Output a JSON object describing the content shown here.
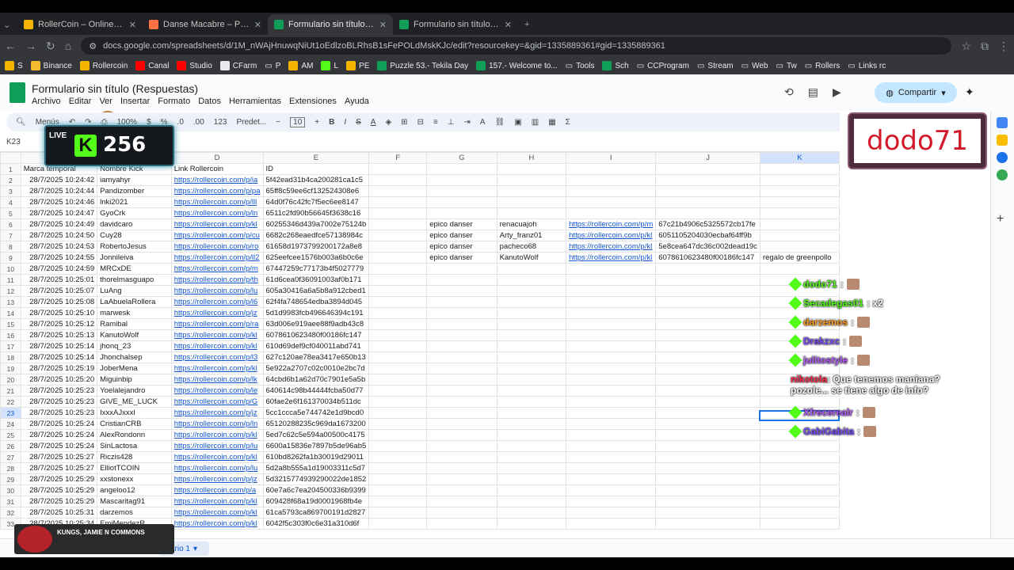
{
  "browser": {
    "tabs": [
      {
        "title": "RollerCoin – Online Bitcoin Mining",
        "active": false,
        "color": "#f4b400"
      },
      {
        "title": "Danse Macabre – Piero",
        "active": false,
        "color": "#ff7043"
      },
      {
        "title": "Formulario sin título (Respuestas)",
        "active": true,
        "color": "#0f9d58"
      },
      {
        "title": "Formulario sin título (Respuestas)",
        "active": false,
        "color": "#0f9d58"
      }
    ],
    "url": "docs.google.com/spreadsheets/d/1M_nWAjHnuwqNiUt1oEdlzoBLRhsB1sFePOLdMskKJc/edit?resourcekey=&gid=1335889361#gid=1335889361",
    "bookmarks": [
      "S",
      "Binance",
      "Rollercoin",
      "Canal",
      "Studio",
      "CFarm",
      "P",
      "AM",
      "L",
      "PE",
      "Puzzle 53.- Tekila Day",
      "157.- Welcome to...",
      "Tools",
      "Sch",
      "CCProgram",
      "Stream",
      "Web",
      "Tw",
      "Rollers",
      "Links rc"
    ]
  },
  "sheet": {
    "title": "Formulario sin título (Respuestas)",
    "menus": [
      "Archivo",
      "Editar",
      "Ver",
      "Insertar",
      "Formato",
      "Datos",
      "Herramientas",
      "Extensiones",
      "Ayuda"
    ],
    "share_label": "Compartir",
    "toolbar": {
      "menus": "Menús",
      "zoom": "100%",
      "currency": "$",
      "percent": "%",
      "dec_minus": ".0",
      "dec_plus": ".00",
      "num_format": "123",
      "font": "Predet...",
      "font_size": "10",
      "sum": "Σ"
    },
    "cell_ref": "K23",
    "columns": [
      "",
      "Marca temporal",
      "Nombre Kick",
      "D",
      "E",
      "F",
      "G",
      "H",
      "I",
      "J",
      "K"
    ],
    "header_row": [
      "Marca temporal",
      "Nombre Kick",
      "Link Rollercoin",
      "ID",
      "",
      "",
      "",
      "",
      "",
      ""
    ],
    "rows": [
      [
        "2",
        "28/7/2025 10:24:42",
        "iamyahyr",
        "https://rollercoin.com/p/ia",
        "5f42ead31b4ca200281ca1c5",
        "",
        "",
        "",
        "",
        "",
        ""
      ],
      [
        "3",
        "28/7/2025 10:24:44",
        "Pandizomber",
        "https://rollercoin.com/p/pa",
        "65ff8c59ee6cf132524308e6",
        "",
        "",
        "",
        "",
        "",
        ""
      ],
      [
        "4",
        "28/7/2025 10:24:46",
        "lnki2021",
        "https://rollercoin.com/p/lll",
        "64d0f76c42fc7f5ec6ee8147",
        "",
        "",
        "",
        "",
        "",
        ""
      ],
      [
        "5",
        "28/7/2025 10:24:47",
        "GyoCrk",
        "https://rollercoin.com/p/ln",
        "6511c2fd90b56645f3638c16",
        "",
        "",
        "",
        "",
        "",
        ""
      ],
      [
        "6",
        "28/7/2025 10:24:49",
        "davidcaro",
        "https://rollercoin.com/p/kl",
        "60255346d439a7002e75124b",
        "",
        "epico danser",
        "renacuajoh",
        "https://rollercoin.com/p/m",
        "67c21b4906c5325572cb17fe",
        ""
      ],
      [
        "7",
        "28/7/2025 10:24:50",
        "Cuy28",
        "https://rollercoin.com/p/cu",
        "6682c268eaedfce57138984c",
        "",
        "epico danser",
        "Arty_franz01",
        "https://rollercoin.com/p/kl",
        "6051105204030ecbaf64ff9b",
        ""
      ],
      [
        "8",
        "28/7/2025 10:24:53",
        "RobertoJesus",
        "https://rollercoin.com/p/ro",
        "61658d1973799200172a8e8",
        "",
        "epico danser",
        "pacheco68",
        "https://rollercoin.com/p/kl",
        "5e8cea647dc36c002dead19c",
        ""
      ],
      [
        "9",
        "28/7/2025 10:24:55",
        "Jonnileiva",
        "https://rollercoin.com/p/ll2",
        "625eefcee1576b003a6b0c6e",
        "",
        "epico danser",
        "KanutoWolf",
        "https://rollercoin.com/p/kl",
        "6078610623480f00186fc147",
        "regalo de greenpollo"
      ],
      [
        "10",
        "28/7/2025 10:24:59",
        "MRCxDE",
        "https://rollercoin.com/p/m",
        "67447259c77173b4f5027779",
        "",
        "",
        "",
        "",
        "",
        ""
      ],
      [
        "11",
        "28/7/2025 10:25:01",
        "thorelmasguapo",
        "https://rollercoin.com/p/th",
        "61d6cea0f36091003af0b171",
        "",
        "",
        "",
        "",
        "",
        ""
      ],
      [
        "12",
        "28/7/2025 10:25:07",
        "LuAng",
        "https://rollercoin.com/p/lu",
        "605a30416a6a5b8a912cbed1",
        "",
        "",
        "",
        "",
        "",
        ""
      ],
      [
        "13",
        "28/7/2025 10:25:08",
        "LaAbuelaRollera",
        "https://rollercoin.com/p/l6",
        "62f4fa748654edba3894d045",
        "",
        "",
        "",
        "",
        "",
        ""
      ],
      [
        "14",
        "28/7/2025 10:25:10",
        "marwesk",
        "https://rollercoin.com/p/jz",
        "5d1d9983fcb496646394c191",
        "",
        "",
        "",
        "",
        "",
        ""
      ],
      [
        "15",
        "28/7/2025 10:25:12",
        "Ramibal",
        "https://rollercoin.com/p/ra",
        "63d006e919aee88f9adb43c8",
        "",
        "",
        "",
        "",
        "",
        ""
      ],
      [
        "16",
        "28/7/2025 10:25:13",
        "KanutoWolf",
        "https://rollercoin.com/p/kl",
        "6078610623480f00186fc147",
        "",
        "",
        "",
        "",
        "",
        ""
      ],
      [
        "17",
        "28/7/2025 10:25:14",
        "jhonq_23",
        "https://rollercoin.com/p/kl",
        "610d69def9cf040011abd741",
        "",
        "",
        "",
        "",
        "",
        ""
      ],
      [
        "18",
        "28/7/2025 10:25:14",
        "Jhonchalsep",
        "https://rollercoin.com/p/l3",
        "627c120ae78ea3417e650b13",
        "",
        "",
        "",
        "",
        "",
        ""
      ],
      [
        "19",
        "28/7/2025 10:25:19",
        "JoberMena",
        "https://rollercoin.com/p/kl",
        "5e922a2707c02c0010e2bc7d",
        "",
        "",
        "",
        "",
        "",
        ""
      ],
      [
        "20",
        "28/7/2025 10:25:20",
        "Miguinbip",
        "https://rollercoin.com/p/lk",
        "64cbd6b1a62d70c7901e5a5b",
        "",
        "",
        "",
        "",
        "",
        ""
      ],
      [
        "21",
        "28/7/2025 10:25:23",
        "Yoelalejandro",
        "https://rollercoin.com/p/le",
        "640614c98b44444fcba50d77",
        "",
        "",
        "",
        "",
        "",
        ""
      ],
      [
        "22",
        "28/7/2025 10:25:23",
        "GIVE_ME_LUCK",
        "https://rollercoin.com/p/G",
        "60fae2e6f161370034b511dc",
        "",
        "",
        "",
        "",
        "",
        ""
      ],
      [
        "23",
        "28/7/2025 10:25:23",
        "IxxxAJxxxl",
        "https://rollercoin.com/p/jz",
        "5cc1ccca5e744742e1d9bcd0",
        "",
        "",
        "",
        "",
        "",
        ""
      ],
      [
        "24",
        "28/7/2025 10:25:24",
        "CristianCRB",
        "https://rollercoin.com/p/ln",
        "65120288235c969da1673200",
        "",
        "",
        "",
        "",
        "",
        ""
      ],
      [
        "25",
        "28/7/2025 10:25:24",
        "AlexRondonn",
        "https://rollercoin.com/p/kl",
        "5ed7c62c5e594a00500c4175",
        "",
        "",
        "",
        "",
        "",
        ""
      ],
      [
        "26",
        "28/7/2025 10:25:24",
        "SinLactosa",
        "https://rollercoin.com/p/lu",
        "6600a15836e7897b5de96ab5",
        "",
        "",
        "",
        "",
        "",
        ""
      ],
      [
        "27",
        "28/7/2025 10:25:27",
        "Riczis428",
        "https://rollercoin.com/p/kl",
        "610bd8262fa1b30019d29011",
        "",
        "",
        "",
        "",
        "",
        ""
      ],
      [
        "28",
        "28/7/2025 10:25:27",
        "ElliotTCOIN",
        "https://rollercoin.com/p/lu",
        "5d2a8b555a1d19003311c5d7",
        "",
        "",
        "",
        "",
        "",
        ""
      ],
      [
        "29",
        "28/7/2025 10:25:29",
        "xxstonexx",
        "https://rollercoin.com/p/jz",
        "5d3215774939290022de1852",
        "",
        "",
        "",
        "",
        "",
        ""
      ],
      [
        "30",
        "28/7/2025 10:25:29",
        "angeloo12",
        "https://rollercoin.com/p/a",
        "60e7a6c7ea204500336b9399",
        "",
        "",
        "",
        "",
        "",
        ""
      ],
      [
        "31",
        "28/7/2025 10:25:29",
        "Mascaritag91",
        "https://rollercoin.com/p/kl",
        "609428f68a19d0001968fb4e",
        "",
        "",
        "",
        "",
        "",
        ""
      ],
      [
        "32",
        "28/7/2025 10:25:31",
        "darzemos",
        "https://rollercoin.com/p/kl",
        "61ca5793ca869700191d2827",
        "",
        "",
        "",
        "",
        "",
        ""
      ],
      [
        "33",
        "28/7/2025 10:25:34",
        "EmiMendezR",
        "https://rollercoin.com/p/kl",
        "6042f5c303f0c6e31a310d6f",
        "",
        "",
        "",
        "",
        "",
        ""
      ]
    ],
    "sheet_tab": "ario 1"
  },
  "overlay": {
    "live_label": "LIVE",
    "viewers": "256",
    "kick_letter": "K",
    "streamer_name": "dodo71",
    "now_playing": "KUNGS, JAMIE N COMMONS",
    "chat": [
      {
        "user": "dodo71",
        "msg": ":",
        "color": "#53fc18"
      },
      {
        "user": "Secadegas01",
        "msg": ": x2",
        "color": "#53fc18"
      },
      {
        "user": "darzemos",
        "msg": ":",
        "color": "#ff9a1f"
      },
      {
        "user": "Drakzxc",
        "msg": ":",
        "color": "#7a4dff"
      },
      {
        "user": "julitostyle",
        "msg": ":",
        "color": "#b65cff"
      },
      {
        "user": "nikotola",
        "msg": ": Que tenemos maniana? pozole... se tiene algo de info?",
        "color": "#ff2a4a"
      },
      {
        "user": "Xfrecerealr",
        "msg": ":",
        "color": "#b65cff"
      },
      {
        "user": "GabiGabita",
        "msg": ":",
        "color": "#7a4dff"
      }
    ]
  }
}
